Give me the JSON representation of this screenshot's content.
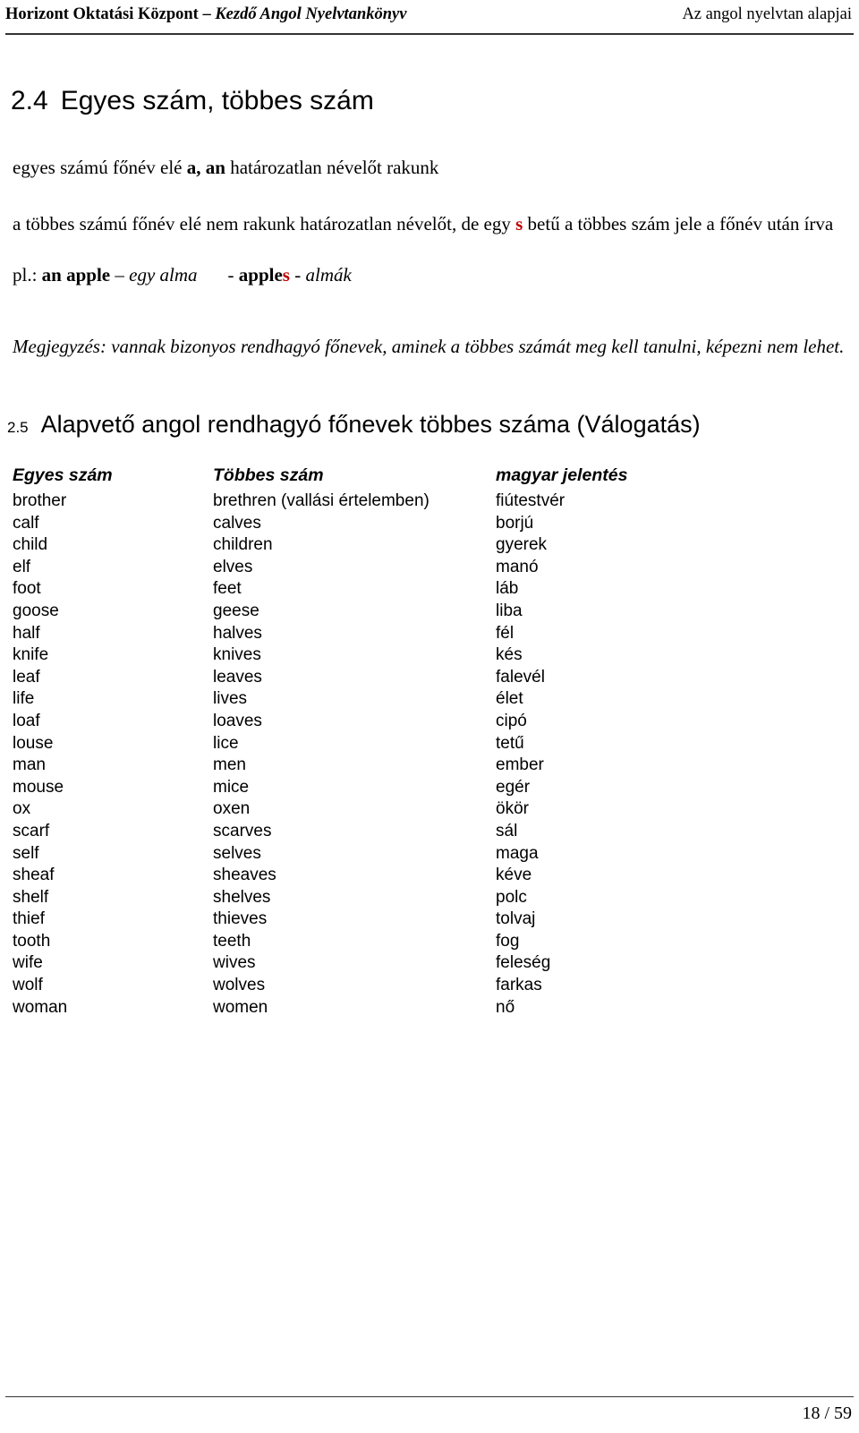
{
  "header": {
    "left_bold": "Horizont Oktatási Központ – ",
    "left_italic": "Kezdő Angol Nyelvtankönyv",
    "right": "Az angol nyelvtan alapjai"
  },
  "section_24": {
    "number": "2.4",
    "title": "Egyes szám, többes szám"
  },
  "body": {
    "line1_part1": "egyes számú főnév elé ",
    "line1_bold": "a, an",
    "line1_part2": " határozatlan névelőt rakunk",
    "line2_part1": "a többes számú főnév elé nem rakunk határozatlan névelőt, de egy ",
    "line2_red": "s",
    "line2_part2": " betű a többes szám jele a főnév után írva",
    "example_prefix": "pl.: ",
    "example_bold1": "an apple",
    "example_dash1": " – ",
    "example_italic1": "egy alma",
    "example_dash2": "- ",
    "example_bold2": "apple",
    "example_red": "s",
    "example_dash3": "  - ",
    "example_italic2": "almák",
    "note": "Megjegyzés: vannak bizonyos rendhagyó főnevek, aminek a többes számát meg kell tanulni, képezni nem lehet."
  },
  "section_25": {
    "number": "2.5",
    "title": "Alapvető angol rendhagyó főnevek többes száma (Válogatás)"
  },
  "table": {
    "headers": [
      "Egyes szám",
      "Többes szám",
      "magyar jelentés"
    ],
    "rows": [
      [
        "brother",
        "brethren (vallási értelemben)",
        "fiútestvér"
      ],
      [
        "calf",
        "calves",
        "borjú"
      ],
      [
        "child",
        "children",
        "gyerek"
      ],
      [
        "elf",
        "elves",
        "manó"
      ],
      [
        "foot",
        "feet",
        "láb"
      ],
      [
        "goose",
        "geese",
        "liba"
      ],
      [
        "half",
        "halves",
        "fél"
      ],
      [
        "knife",
        "knives",
        "kés"
      ],
      [
        "leaf",
        "leaves",
        "falevél"
      ],
      [
        "life",
        "lives",
        "élet"
      ],
      [
        "loaf",
        "loaves",
        "cipó"
      ],
      [
        "louse",
        "lice",
        "tetű"
      ],
      [
        "man",
        "men",
        "ember"
      ],
      [
        "mouse",
        "mice",
        "egér"
      ],
      [
        "ox",
        "oxen",
        "ökör"
      ],
      [
        "scarf",
        "scarves",
        "sál"
      ],
      [
        "self",
        "selves",
        "maga"
      ],
      [
        "sheaf",
        "sheaves",
        "kéve"
      ],
      [
        "shelf",
        "shelves",
        "polc"
      ],
      [
        "thief",
        "thieves",
        "tolvaj"
      ],
      [
        "tooth",
        "teeth",
        "fog"
      ],
      [
        "wife",
        "wives",
        "feleség"
      ],
      [
        "wolf",
        "wolves",
        "farkas"
      ],
      [
        "woman",
        "women",
        "nő"
      ]
    ]
  },
  "footer": {
    "page": "18 / 59"
  },
  "colors": {
    "accent_red": "#c00000",
    "rule": "#333333",
    "text": "#000000"
  }
}
